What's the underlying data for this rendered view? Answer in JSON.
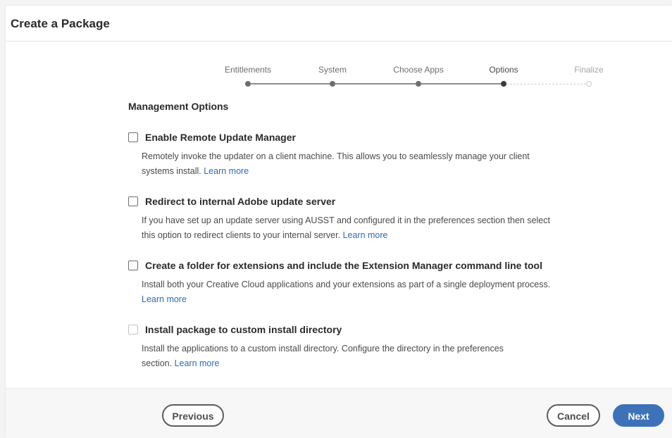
{
  "dialog": {
    "title": "Create a Package"
  },
  "steps": [
    {
      "label": "Entitlements",
      "state": "done"
    },
    {
      "label": "System",
      "state": "done"
    },
    {
      "label": "Choose Apps",
      "state": "done"
    },
    {
      "label": "Options",
      "state": "current"
    },
    {
      "label": "Finalize",
      "state": "future"
    }
  ],
  "section": {
    "title": "Management Options"
  },
  "options": [
    {
      "label": "Enable Remote Update Manager",
      "checked": false,
      "enabled": true,
      "desc_line1": "Remotely invoke the updater on a client machine. This allows you to seamlessly manage your client",
      "desc_line2": "systems install. ",
      "link": "Learn more"
    },
    {
      "label": "Redirect to internal Adobe update server",
      "checked": false,
      "enabled": true,
      "desc_line1": "If you have set up an update server using AUSST and configured it in the preferences section then select",
      "desc_line2": "this option to redirect clients to your internal server. ",
      "link": "Learn more"
    },
    {
      "label": "Create a folder for extensions and include the Extension Manager command line tool",
      "checked": false,
      "enabled": true,
      "desc_line1": "Install both your Creative Cloud applications and your extensions as part of a single deployment process.",
      "desc_line2": "",
      "link": "Learn more"
    },
    {
      "label": "Install package to custom install directory",
      "checked": false,
      "enabled": false,
      "desc_line1": "Install the applications to a custom install directory. Configure the directory in the preferences",
      "desc_line2": "section. ",
      "link": "Learn more"
    }
  ],
  "footer": {
    "previous_label": "Previous",
    "cancel_label": "Cancel",
    "next_label": "Next"
  },
  "colors": {
    "accent": "#3e72b8",
    "link": "#2d6bb4"
  }
}
